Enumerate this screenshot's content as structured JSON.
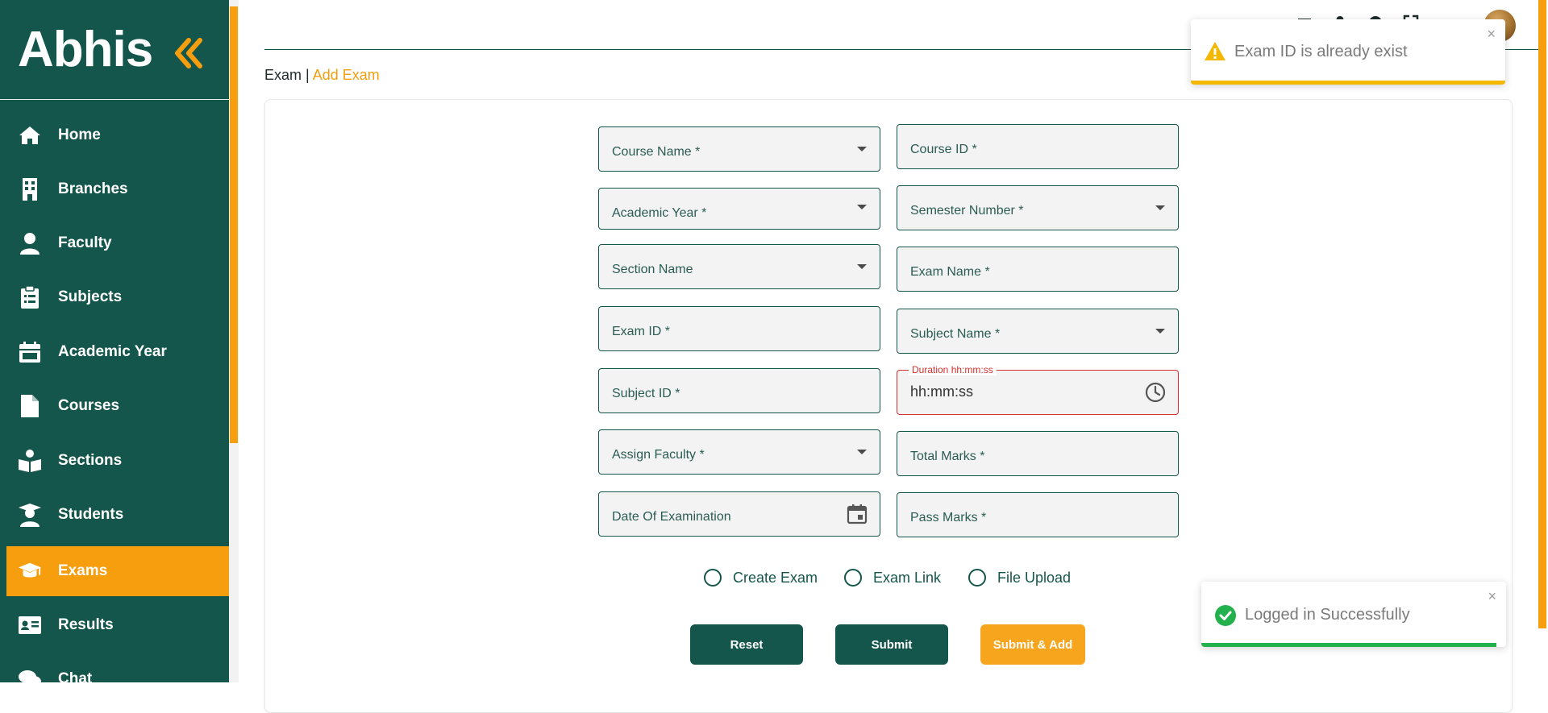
{
  "brand": {
    "logo_text": "Abhis"
  },
  "sidebar": {
    "items": [
      {
        "label": "Home",
        "icon": "home-icon"
      },
      {
        "label": "Branches",
        "icon": "building-icon"
      },
      {
        "label": "Faculty",
        "icon": "user-icon"
      },
      {
        "label": "Subjects",
        "icon": "clipboard-icon"
      },
      {
        "label": "Academic Year",
        "icon": "calendar-icon"
      },
      {
        "label": "Courses",
        "icon": "file-icon"
      },
      {
        "label": "Sections",
        "icon": "book-reader-icon"
      },
      {
        "label": "Students",
        "icon": "graduate-icon"
      },
      {
        "label": "Exams",
        "icon": "graduation-cap-icon",
        "active": true
      },
      {
        "label": "Results",
        "icon": "id-card-icon"
      },
      {
        "label": "Chat",
        "icon": "chat-icon"
      }
    ]
  },
  "breadcrumb": {
    "root": "Exam",
    "separator": "|",
    "current": "Add Exam"
  },
  "form": {
    "course_name": "Course Name *",
    "course_id": "Course ID *",
    "academic_year": "Academic Year *",
    "semester_number": "Semester Number *",
    "section_name": "Section Name",
    "exam_name": "Exam Name *",
    "exam_id": "Exam ID *",
    "subject_name": "Subject Name *",
    "subject_id": "Subject ID *",
    "duration_label": "Duration hh:mm:ss",
    "duration_value": "hh:mm:ss",
    "assign_faculty": "Assign Faculty *",
    "total_marks": "Total Marks *",
    "date_of_examination": "Date Of Examination",
    "pass_marks": "Pass Marks *"
  },
  "radios": {
    "create_exam": "Create Exam",
    "exam_link": "Exam Link",
    "file_upload": "File Upload"
  },
  "buttons": {
    "reset": "Reset",
    "submit": "Submit",
    "submit_add": "Submit & Add"
  },
  "toasts": {
    "warning": {
      "message": "Exam ID is already exist",
      "close": "×"
    },
    "success": {
      "message": "Logged in Successfully",
      "close": "×"
    }
  },
  "colors": {
    "primary": "#14564b",
    "accent": "#f79e0f",
    "error": "#d32f2f",
    "success": "#22b14c",
    "warning": "#f5b800"
  }
}
